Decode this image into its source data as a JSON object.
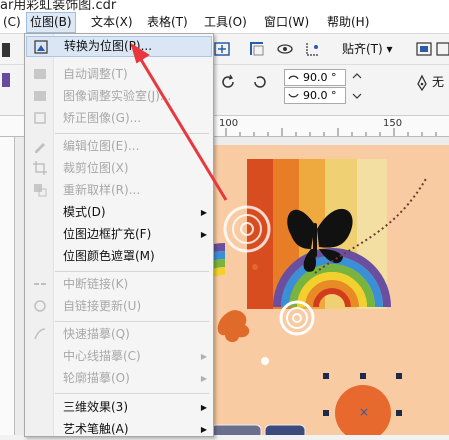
{
  "window": {
    "title_fragment": "ar用彩虹装饰图.cdr"
  },
  "menubar": {
    "items": [
      {
        "label": "(C)"
      },
      {
        "label": "位图(B)"
      },
      {
        "label": "文本(X)"
      },
      {
        "label": "表格(T)"
      },
      {
        "label": "工具(O)"
      },
      {
        "label": "窗口(W)"
      },
      {
        "label": "帮助(H)"
      }
    ]
  },
  "toolbar": {
    "snap_label": "贴齐(T)",
    "rotate_x": "90.0 °",
    "rotate_y": "90.0 °",
    "outline_label": "无"
  },
  "ruler": {
    "labels": [
      "100",
      "150"
    ]
  },
  "menu": {
    "items": [
      {
        "label": "转换为位图(P)...",
        "disabled": false,
        "hover": true
      },
      {
        "label": "自动调整(T)",
        "disabled": true
      },
      {
        "label": "图像调整实验室(J)...",
        "disabled": true
      },
      {
        "label": "矫正图像(G)...",
        "disabled": true
      },
      {
        "label": "编辑位图(E)...",
        "disabled": true
      },
      {
        "label": "裁剪位图(X)",
        "disabled": true
      },
      {
        "label": "重新取样(R)...",
        "disabled": true
      },
      {
        "label": "模式(D)",
        "disabled": false,
        "submenu": true
      },
      {
        "label": "位图边框扩充(F)",
        "disabled": false,
        "submenu": true
      },
      {
        "label": "位图颜色遮罩(M)",
        "disabled": false
      },
      {
        "label": "中断链接(K)",
        "disabled": true
      },
      {
        "label": "自链接更新(U)",
        "disabled": true
      },
      {
        "label": "快速描摹(Q)",
        "disabled": true
      },
      {
        "label": "中心线描摹(C)",
        "disabled": true,
        "submenu": true
      },
      {
        "label": "轮廓描摹(O)",
        "disabled": true,
        "submenu": true
      },
      {
        "label": "三维效果(3)",
        "disabled": false,
        "submenu": true
      },
      {
        "label": "艺术笔触(A)",
        "disabled": false,
        "submenu": true
      }
    ]
  },
  "colors": {
    "annotation_arrow": "#e8383d",
    "menu_hover": "#dae6f3",
    "canvas_bg": "#f9cba3"
  }
}
